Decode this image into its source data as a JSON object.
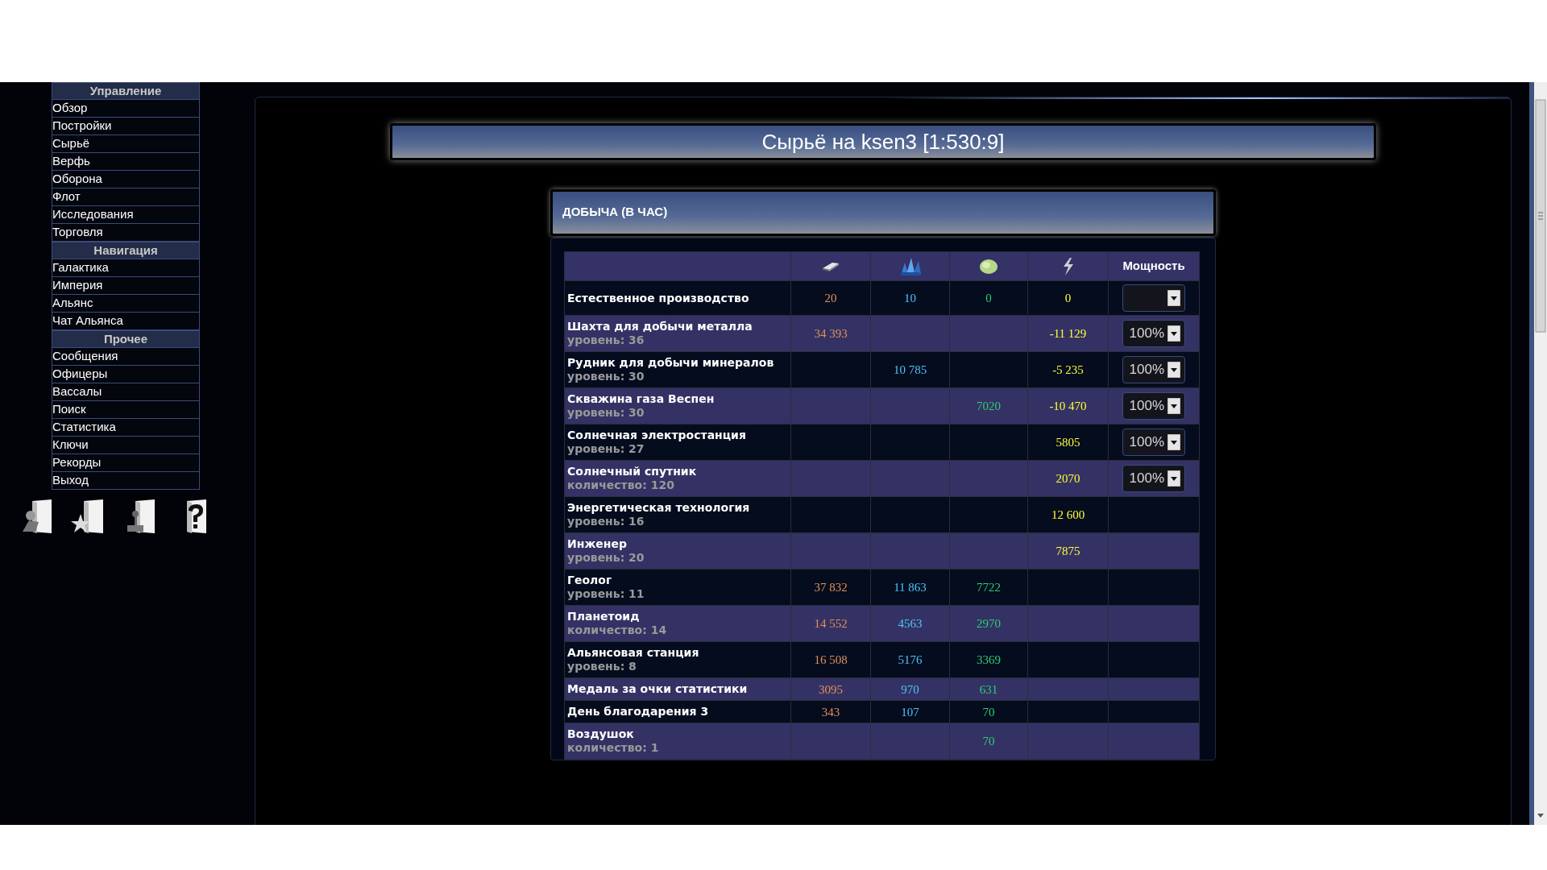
{
  "sidebar": {
    "sections": [
      {
        "title": "Управление",
        "items": [
          "Обзор",
          "Постройки",
          "Сырьё",
          "Верфь",
          "Оборона",
          "Флот",
          "Исследования",
          "Торговля"
        ]
      },
      {
        "title": "Навигация",
        "items": [
          "Галактика",
          "Империя",
          "Альянс",
          "Чат Альянса"
        ]
      },
      {
        "title": "Прочее",
        "items": [
          "Сообщения",
          "Офицеры",
          "Вассалы",
          "Поиск",
          "Статистика",
          "Ключи",
          "Рекорды",
          "Выход"
        ]
      }
    ]
  },
  "page_title": "Сырьё на ksen3 [1:530:9]",
  "section_title": "ДОБЫЧА (В ЧАС)",
  "table": {
    "power_header": "Мощность",
    "rows": [
      {
        "name": "Естественное производство",
        "metal": "20",
        "crystal": "10",
        "deuterium": "0",
        "energy": "0",
        "power": {
          "kind": "select"
        }
      },
      {
        "name": "Шахта для добычи металла",
        "sub": "уровень: 36",
        "metal": "34 393",
        "energy": "-11 129",
        "power": {
          "kind": "select",
          "value": "100%"
        }
      },
      {
        "name": "Рудник для добычи минералов",
        "sub": "уровень: 30",
        "crystal": "10 785",
        "energy": "-5 235",
        "power": {
          "kind": "select",
          "value": "100%"
        }
      },
      {
        "name": "Скважина газа Веспен",
        "sub": "уровень: 30",
        "deuterium": "7020",
        "energy": "-10 470",
        "power": {
          "kind": "select",
          "value": "100%"
        }
      },
      {
        "name": "Солнечная электростанция",
        "sub": "уровень: 27",
        "energy": "5805",
        "power": {
          "kind": "select",
          "value": "100%"
        }
      },
      {
        "name": "Солнечный спутник",
        "sub": "количество: 120",
        "energy": "2070",
        "power": {
          "kind": "select",
          "value": "100%"
        }
      },
      {
        "name": "Энергетическая технология",
        "sub": "уровень: 16",
        "energy": "12 600",
        "power": {
          "kind": "none"
        }
      },
      {
        "name": "Инженер",
        "sub": "уровень: 20",
        "energy": "7875",
        "power": {
          "kind": "none"
        }
      },
      {
        "name": "Геолог",
        "sub": "уровень: 11",
        "metal": "37 832",
        "crystal": "11 863",
        "deuterium": "7722",
        "power": {
          "kind": "none"
        }
      },
      {
        "name": "Планетоид",
        "sub": "количество: 14",
        "metal": "14 552",
        "crystal": "4563",
        "deuterium": "2970",
        "power": {
          "kind": "none"
        }
      },
      {
        "name": "Альянсовая станция",
        "sub": "уровень: 8",
        "metal": "16 508",
        "crystal": "5176",
        "deuterium": "3369",
        "power": {
          "kind": "none"
        }
      },
      {
        "name": "Медаль за очки статистики",
        "metal": "3095",
        "crystal": "970",
        "deuterium": "631",
        "power": {
          "kind": "none"
        }
      },
      {
        "name": "День благодарения 3",
        "metal": "343",
        "crystal": "107",
        "deuterium": "70",
        "power": {
          "kind": "none"
        }
      },
      {
        "name": "Воздушок",
        "sub": "количество: 1",
        "deuterium": "70",
        "power": {
          "kind": "none"
        }
      }
    ]
  }
}
